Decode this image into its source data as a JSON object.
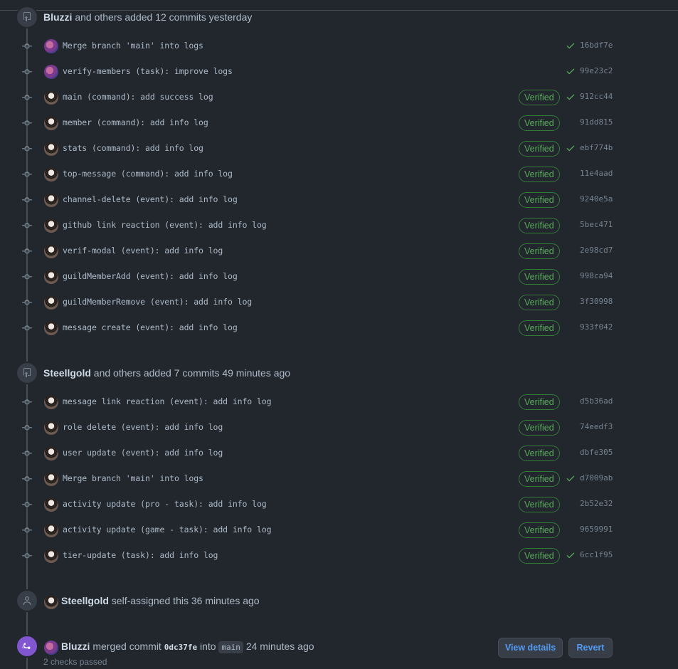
{
  "events": [
    {
      "id": "push1",
      "author": "Bluzzi",
      "text": "and others added 12 commits yesterday"
    },
    {
      "id": "push2",
      "author": "Steellgold",
      "text": "and others added 7 commits 49 minutes ago"
    },
    {
      "id": "assign",
      "author": "Steellgold",
      "text": "self-assigned this 36 minutes ago"
    },
    {
      "id": "merge",
      "author": "Bluzzi",
      "text_before": "merged commit",
      "commit": "0dc37fe",
      "text_mid": "into",
      "branch": "main",
      "text_after": "24 minutes ago",
      "checks": "2 checks passed",
      "view_details": "View details",
      "revert": "Revert"
    }
  ],
  "commit_groups": [
    [
      {
        "avatar": "bluzzi",
        "message": "Merge branch 'main' into logs",
        "verified": false,
        "check": true,
        "sha": "16bdf7e"
      },
      {
        "avatar": "bluzzi",
        "message": "verify-members (task): improve logs",
        "verified": false,
        "check": true,
        "sha": "99e23c2"
      },
      {
        "avatar": "steellgold",
        "message": "main (command): add success log",
        "verified": true,
        "check": true,
        "sha": "912cc44"
      },
      {
        "avatar": "steellgold",
        "message": "member (command): add info log",
        "verified": true,
        "check": false,
        "sha": "91dd815"
      },
      {
        "avatar": "steellgold",
        "message": "stats (command): add info log",
        "verified": true,
        "check": true,
        "sha": "ebf774b"
      },
      {
        "avatar": "steellgold",
        "message": "top-message (command): add info log",
        "verified": true,
        "check": false,
        "sha": "11e4aad"
      },
      {
        "avatar": "steellgold",
        "message": "channel-delete (event): add info log",
        "verified": true,
        "check": false,
        "sha": "9240e5a"
      },
      {
        "avatar": "steellgold",
        "message": "github link reaction (event): add info log",
        "verified": true,
        "check": false,
        "sha": "5bec471"
      },
      {
        "avatar": "steellgold",
        "message": "verif-modal (event): add info log",
        "verified": true,
        "check": false,
        "sha": "2e98cd7"
      },
      {
        "avatar": "steellgold",
        "message": "guildMemberAdd (event): add info log",
        "verified": true,
        "check": false,
        "sha": "998ca94"
      },
      {
        "avatar": "steellgold",
        "message": "guildMemberRemove (event): add info log",
        "verified": true,
        "check": false,
        "sha": "3f30998"
      },
      {
        "avatar": "steellgold",
        "message": "message create (event): add info log",
        "verified": true,
        "check": false,
        "sha": "933f042"
      }
    ],
    [
      {
        "avatar": "steellgold",
        "message": "message link reaction (event): add info log",
        "verified": true,
        "check": false,
        "sha": "d5b36ad"
      },
      {
        "avatar": "steellgold",
        "message": "role delete (event): add info log",
        "verified": true,
        "check": false,
        "sha": "74eedf3"
      },
      {
        "avatar": "steellgold",
        "message": "user update (event): add info log",
        "verified": true,
        "check": false,
        "sha": "dbfe305"
      },
      {
        "avatar": "steellgold",
        "message": "Merge branch 'main' into logs",
        "verified": true,
        "check": true,
        "sha": "d7009ab"
      },
      {
        "avatar": "steellgold",
        "message": "activity update (pro - task): add info log",
        "verified": true,
        "check": false,
        "sha": "2b52e32"
      },
      {
        "avatar": "steellgold",
        "message": "activity update (game - task): add info log",
        "verified": true,
        "check": false,
        "sha": "9659991"
      },
      {
        "avatar": "steellgold",
        "message": "tier-update (task): add info log",
        "verified": true,
        "check": true,
        "sha": "6cc1f95"
      }
    ]
  ],
  "verified_label": "Verified",
  "colors": {
    "background": "#22272e",
    "verified": "#57ab5a",
    "link": "#539bf5",
    "merged": "#8256d0"
  }
}
